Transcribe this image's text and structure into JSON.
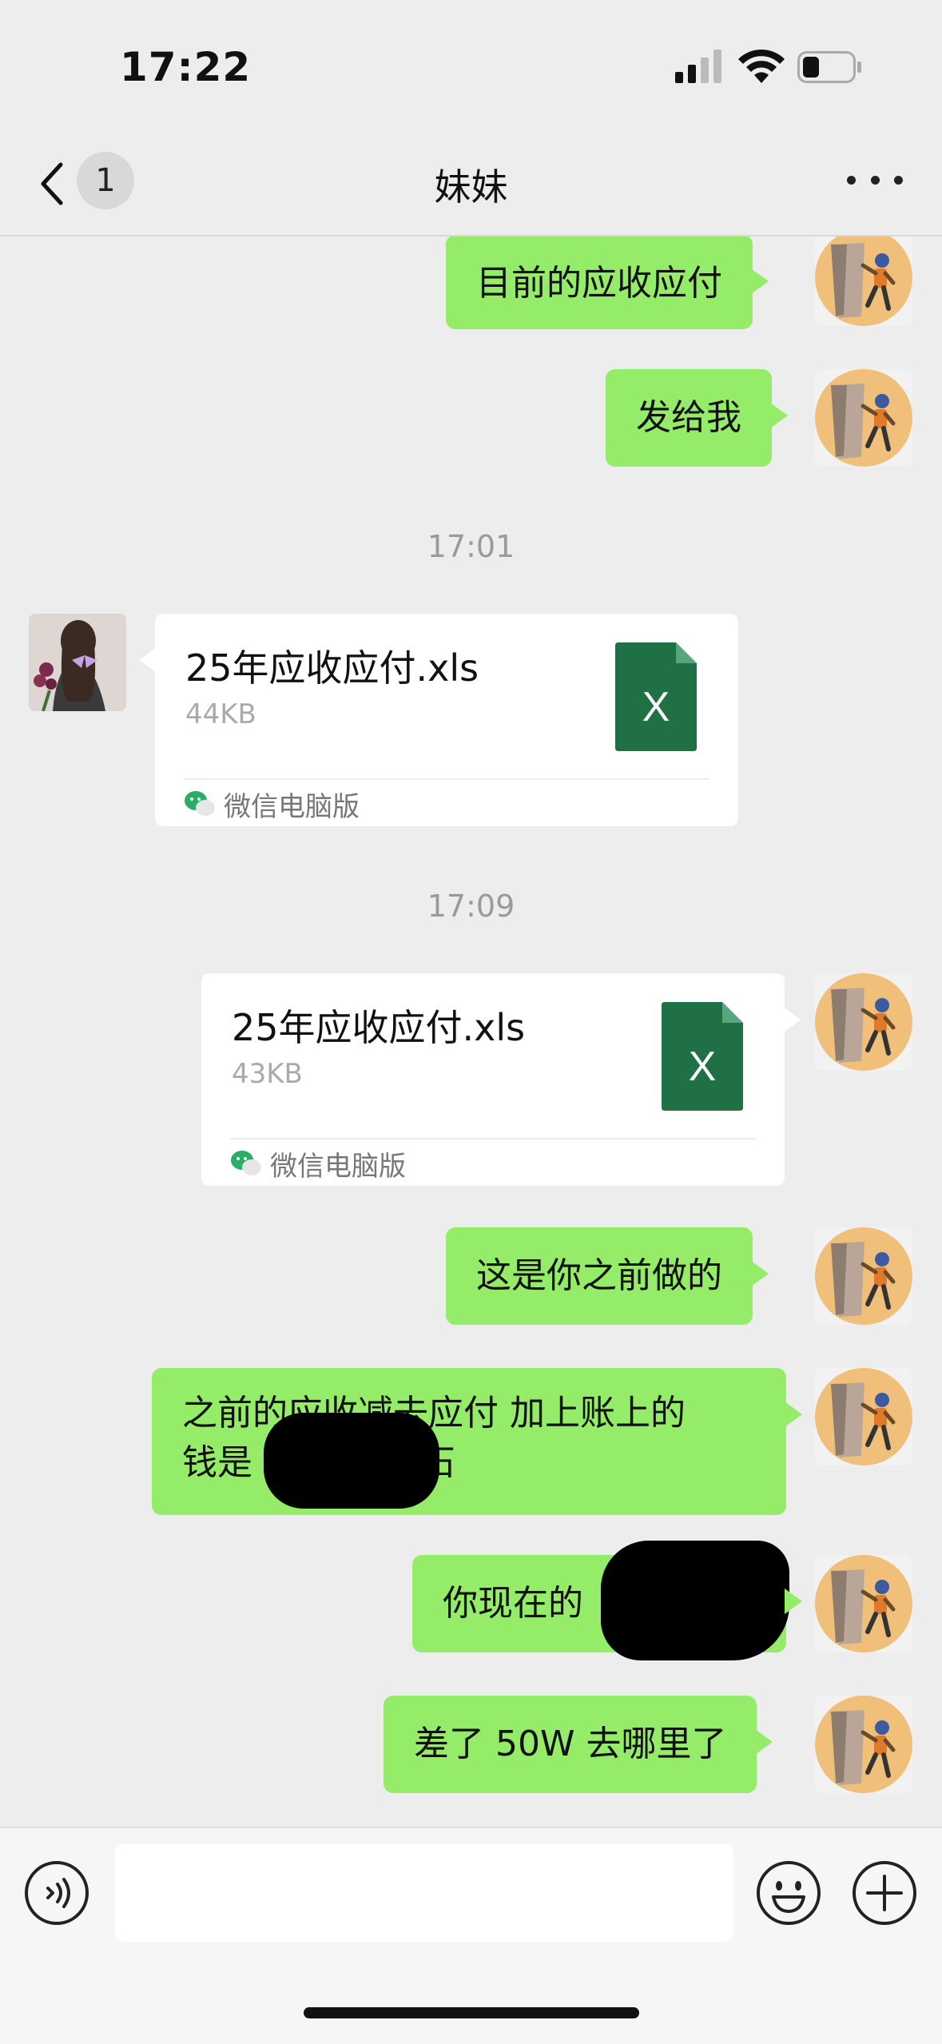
{
  "status_bar": {
    "time": "17:22"
  },
  "header": {
    "back_badge": "1",
    "title": "妹妹"
  },
  "messages": [
    {
      "from": "me",
      "text": "目前的应收应付"
    },
    {
      "from": "me",
      "text": "发给我"
    },
    {
      "type": "timestamp",
      "text": "17:01"
    },
    {
      "from": "sister",
      "file_name": "25年应收应付.xls",
      "file_size": "44KB",
      "source": "微信电脑版",
      "file_icon_letter": "X"
    },
    {
      "type": "timestamp",
      "text": "17:09"
    },
    {
      "from": "me",
      "file_name": "25年应收应付.xls",
      "file_size": "43KB",
      "source": "微信电脑版",
      "file_icon_letter": "X"
    },
    {
      "from": "me",
      "text": "这是你之前做的"
    },
    {
      "from": "me",
      "text_line1": "之前的应收减去应付 加上账上的",
      "text_line2": "钱是",
      "text_line2_tail": "石"
    },
    {
      "from": "me",
      "text": "你现在的"
    },
    {
      "from": "me",
      "text": "差了 50W 去哪里了"
    }
  ],
  "colors": {
    "bubble_me": "#95ec69",
    "background": "#ededed",
    "excel_green": "#1f7145"
  },
  "icons": {
    "back": "chevron-left-icon",
    "more": "more-dots-icon",
    "voice": "voice-icon",
    "emoji": "emoji-icon",
    "plus": "plus-icon",
    "file": "excel-file-icon",
    "source": "wechat-icon"
  }
}
